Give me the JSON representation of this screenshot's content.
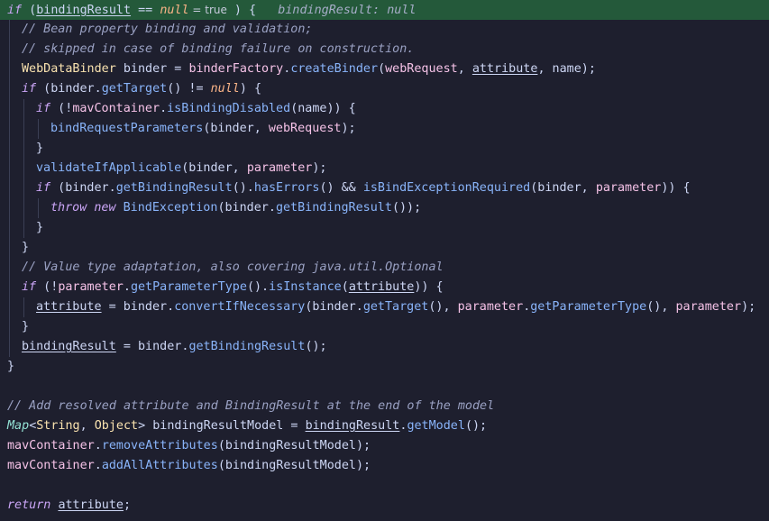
{
  "editor": {
    "lines": [
      {
        "indent": 0,
        "current": true,
        "tokens": [
          {
            "t": "if",
            "c": "kw"
          },
          {
            "t": " (",
            "c": "punc"
          },
          {
            "t": "bindingResult",
            "c": "var ul"
          },
          {
            "t": " == ",
            "c": "op"
          },
          {
            "t": "null",
            "c": "nul"
          },
          {
            "t": " = true",
            "c": "hint"
          },
          {
            "t": " ) {",
            "c": "punc"
          },
          {
            "t": "   bindingResult: null",
            "c": "inlay"
          }
        ]
      },
      {
        "indent": 1,
        "tokens": [
          {
            "t": "// Bean property binding and validation;",
            "c": "cm"
          }
        ]
      },
      {
        "indent": 1,
        "tokens": [
          {
            "t": "// skipped in case of binding failure on construction.",
            "c": "cm"
          }
        ]
      },
      {
        "indent": 1,
        "tokens": [
          {
            "t": "WebDataBinder",
            "c": "type"
          },
          {
            "t": " binder = ",
            "c": "var"
          },
          {
            "t": "binderFactory",
            "c": "param"
          },
          {
            "t": ".",
            "c": "punc"
          },
          {
            "t": "createBinder",
            "c": "fn"
          },
          {
            "t": "(",
            "c": "punc"
          },
          {
            "t": "webRequest",
            "c": "param"
          },
          {
            "t": ", ",
            "c": "punc"
          },
          {
            "t": "attribute",
            "c": "var ul"
          },
          {
            "t": ", name);",
            "c": "var"
          }
        ]
      },
      {
        "indent": 1,
        "tokens": [
          {
            "t": "if",
            "c": "kw"
          },
          {
            "t": " (binder.",
            "c": "var"
          },
          {
            "t": "getTarget",
            "c": "fn"
          },
          {
            "t": "() != ",
            "c": "punc"
          },
          {
            "t": "null",
            "c": "nul"
          },
          {
            "t": ") {",
            "c": "punc"
          }
        ]
      },
      {
        "indent": 2,
        "tokens": [
          {
            "t": "if",
            "c": "kw"
          },
          {
            "t": " (!",
            "c": "punc"
          },
          {
            "t": "mavContainer",
            "c": "param"
          },
          {
            "t": ".",
            "c": "punc"
          },
          {
            "t": "isBindingDisabled",
            "c": "fn"
          },
          {
            "t": "(name)) {",
            "c": "var"
          }
        ]
      },
      {
        "indent": 3,
        "tokens": [
          {
            "t": "bindRequestParameters",
            "c": "fn"
          },
          {
            "t": "(binder, ",
            "c": "var"
          },
          {
            "t": "webRequest",
            "c": "param"
          },
          {
            "t": ");",
            "c": "punc"
          }
        ]
      },
      {
        "indent": 2,
        "tokens": [
          {
            "t": "}",
            "c": "punc"
          }
        ]
      },
      {
        "indent": 2,
        "tokens": [
          {
            "t": "validateIfApplicable",
            "c": "fn"
          },
          {
            "t": "(binder, ",
            "c": "var"
          },
          {
            "t": "parameter",
            "c": "param"
          },
          {
            "t": ");",
            "c": "punc"
          }
        ]
      },
      {
        "indent": 2,
        "tokens": [
          {
            "t": "if",
            "c": "kw"
          },
          {
            "t": " (binder.",
            "c": "var"
          },
          {
            "t": "getBindingResult",
            "c": "fn"
          },
          {
            "t": "().",
            "c": "punc"
          },
          {
            "t": "hasErrors",
            "c": "fn"
          },
          {
            "t": "() && ",
            "c": "punc"
          },
          {
            "t": "isBindExceptionRequired",
            "c": "fn"
          },
          {
            "t": "(binder, ",
            "c": "var"
          },
          {
            "t": "parameter",
            "c": "param"
          },
          {
            "t": ")) {",
            "c": "punc"
          }
        ]
      },
      {
        "indent": 3,
        "tokens": [
          {
            "t": "throw",
            "c": "kw"
          },
          {
            "t": " ",
            "c": "punc"
          },
          {
            "t": "new",
            "c": "kw"
          },
          {
            "t": " ",
            "c": "punc"
          },
          {
            "t": "BindException",
            "c": "fn"
          },
          {
            "t": "(binder.",
            "c": "var"
          },
          {
            "t": "getBindingResult",
            "c": "fn"
          },
          {
            "t": "());",
            "c": "punc"
          }
        ]
      },
      {
        "indent": 2,
        "tokens": [
          {
            "t": "}",
            "c": "punc"
          }
        ]
      },
      {
        "indent": 1,
        "tokens": [
          {
            "t": "}",
            "c": "punc"
          }
        ]
      },
      {
        "indent": 1,
        "tokens": [
          {
            "t": "// Value type adaptation, also covering java.util.Optional",
            "c": "cm"
          }
        ]
      },
      {
        "indent": 1,
        "tokens": [
          {
            "t": "if",
            "c": "kw"
          },
          {
            "t": " (!",
            "c": "punc"
          },
          {
            "t": "parameter",
            "c": "param"
          },
          {
            "t": ".",
            "c": "punc"
          },
          {
            "t": "getParameterType",
            "c": "fn"
          },
          {
            "t": "().",
            "c": "punc"
          },
          {
            "t": "isInstance",
            "c": "fn"
          },
          {
            "t": "(",
            "c": "punc"
          },
          {
            "t": "attribute",
            "c": "var ul"
          },
          {
            "t": ")) {",
            "c": "punc"
          }
        ]
      },
      {
        "indent": 2,
        "tokens": [
          {
            "t": "attribute",
            "c": "var ul"
          },
          {
            "t": " = binder.",
            "c": "var"
          },
          {
            "t": "convertIfNecessary",
            "c": "fn"
          },
          {
            "t": "(binder.",
            "c": "var"
          },
          {
            "t": "getTarget",
            "c": "fn"
          },
          {
            "t": "(), ",
            "c": "punc"
          },
          {
            "t": "parameter",
            "c": "param"
          },
          {
            "t": ".",
            "c": "punc"
          },
          {
            "t": "getParameterType",
            "c": "fn"
          },
          {
            "t": "(), ",
            "c": "punc"
          },
          {
            "t": "parameter",
            "c": "param"
          },
          {
            "t": ");",
            "c": "punc"
          }
        ]
      },
      {
        "indent": 1,
        "tokens": [
          {
            "t": "}",
            "c": "punc"
          }
        ]
      },
      {
        "indent": 1,
        "tokens": [
          {
            "t": "bindingResult",
            "c": "var ul"
          },
          {
            "t": " = binder.",
            "c": "var"
          },
          {
            "t": "getBindingResult",
            "c": "fn"
          },
          {
            "t": "();",
            "c": "punc"
          }
        ]
      },
      {
        "indent": 0,
        "tokens": [
          {
            "t": "}",
            "c": "punc"
          }
        ]
      },
      {
        "indent": 0,
        "tokens": []
      },
      {
        "indent": 0,
        "tokens": [
          {
            "t": "// Add resolved attribute and BindingResult at the end of the model",
            "c": "cm"
          }
        ]
      },
      {
        "indent": 0,
        "tokens": [
          {
            "t": "Map",
            "c": "type-g"
          },
          {
            "t": "<",
            "c": "punc"
          },
          {
            "t": "String",
            "c": "type"
          },
          {
            "t": ", ",
            "c": "punc"
          },
          {
            "t": "Object",
            "c": "type"
          },
          {
            "t": "> bindingResultModel = ",
            "c": "var"
          },
          {
            "t": "bindingResult",
            "c": "var ul"
          },
          {
            "t": ".",
            "c": "punc"
          },
          {
            "t": "getModel",
            "c": "fn"
          },
          {
            "t": "();",
            "c": "punc"
          }
        ]
      },
      {
        "indent": 0,
        "tokens": [
          {
            "t": "mavContainer",
            "c": "param"
          },
          {
            "t": ".",
            "c": "punc"
          },
          {
            "t": "removeAttributes",
            "c": "fn"
          },
          {
            "t": "(bindingResultModel);",
            "c": "var"
          }
        ]
      },
      {
        "indent": 0,
        "tokens": [
          {
            "t": "mavContainer",
            "c": "param"
          },
          {
            "t": ".",
            "c": "punc"
          },
          {
            "t": "addAllAttributes",
            "c": "fn"
          },
          {
            "t": "(bindingResultModel);",
            "c": "var"
          }
        ]
      },
      {
        "indent": 0,
        "tokens": []
      },
      {
        "indent": 0,
        "tokens": [
          {
            "t": "return",
            "c": "kw"
          },
          {
            "t": " ",
            "c": "punc"
          },
          {
            "t": "attribute",
            "c": "var ul"
          },
          {
            "t": ";",
            "c": "punc"
          }
        ]
      }
    ]
  }
}
